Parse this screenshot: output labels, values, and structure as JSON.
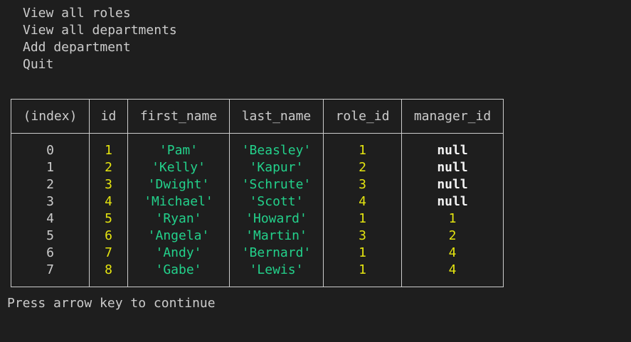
{
  "menu": {
    "items": [
      "View all roles",
      "View all departments",
      "Add department",
      "Quit"
    ]
  },
  "table": {
    "headers": [
      "(index)",
      "id",
      "first_name",
      "last_name",
      "role_id",
      "manager_id"
    ],
    "rows": [
      [
        "0",
        "1",
        "'Pam'",
        "'Beasley'",
        "1",
        "null"
      ],
      [
        "1",
        "2",
        "'Kelly'",
        "'Kapur'",
        "2",
        "null"
      ],
      [
        "2",
        "3",
        "'Dwight'",
        "'Schrute'",
        "3",
        "null"
      ],
      [
        "3",
        "4",
        "'Michael'",
        "'Scott'",
        "4",
        "null"
      ],
      [
        "4",
        "5",
        "'Ryan'",
        "'Howard'",
        "1",
        "1"
      ],
      [
        "5",
        "6",
        "'Angela'",
        "'Martin'",
        "3",
        "2"
      ],
      [
        "6",
        "7",
        "'Andy'",
        "'Bernard'",
        "1",
        "4"
      ],
      [
        "7",
        "8",
        "'Gabe'",
        "'Lewis'",
        "1",
        "4"
      ]
    ]
  },
  "prompt": "Press arrow key to continue",
  "colors": {
    "background": "#1e1e1e",
    "text": "#cccccc",
    "number": "#e5e510",
    "string": "#23d18b",
    "null": "#f2f2f2"
  }
}
